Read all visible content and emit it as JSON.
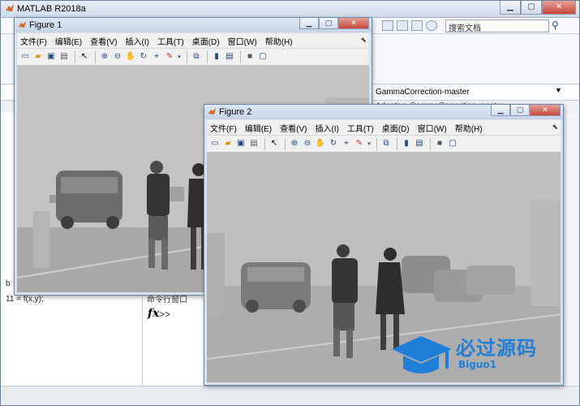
{
  "main": {
    "title": "MATLAB R2018a",
    "search_placeholder": "搜索文档",
    "current_folder": "GammaCorrection-master",
    "path_fragment": "Adaptive-GammaCorrection-master",
    "left_panel_label_b": "b",
    "left_panel_line_11": "11 = f(x,y);",
    "command_window_header": "命令行窗口",
    "command_prompt": ">>",
    "fx_label": "fx"
  },
  "figure1": {
    "title": "Figure 1",
    "menu": [
      "文件(F)",
      "编辑(E)",
      "查看(V)",
      "插入(I)",
      "工具(T)",
      "桌面(D)",
      "窗口(W)",
      "帮助(H)"
    ]
  },
  "figure2": {
    "title": "Figure 2",
    "menu": [
      "文件(F)",
      "编辑(E)",
      "查看(V)",
      "插入(I)",
      "工具(T)",
      "桌面(D)",
      "窗口(W)",
      "帮助(H)"
    ]
  },
  "toolbar_icons": [
    "new-figure-icon",
    "open-file-icon",
    "save-icon",
    "print-icon",
    "pointer-icon",
    "zoom-in-icon",
    "zoom-out-icon",
    "pan-icon",
    "rotate-3d-icon",
    "data-cursor-icon",
    "brush-icon",
    "link-plot-icon",
    "colorbar-icon",
    "legend-icon",
    "hide-plot-tools-icon",
    "show-plot-tools-icon"
  ],
  "watermark": {
    "text_cn": "必过源码",
    "text_en": "Biguo1"
  },
  "colors": {
    "accent": "#1f7fd8",
    "titlebar": "#cfdbe9",
    "close": "#c6473a",
    "fog": "#bfbfbf"
  }
}
